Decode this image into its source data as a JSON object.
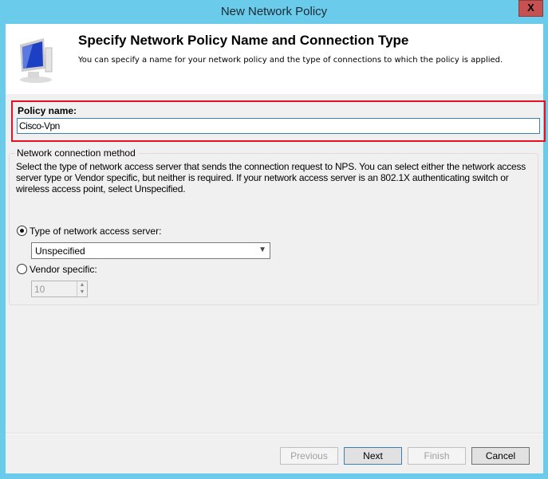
{
  "window": {
    "title": "New Network Policy",
    "close_label": "X"
  },
  "header": {
    "title": "Specify Network Policy Name and Connection Type",
    "subtitle": "You can specify a name for your network policy and the type of connections to which the policy is applied.",
    "icon": "computer-monitor-icon"
  },
  "policy": {
    "label": "Policy name:",
    "value": "Cisco-Vpn",
    "highlight_color": "#e81123"
  },
  "method": {
    "legend": "Network connection method",
    "description": "Select the type of network access server that sends the connection request to NPS. You can select either the network access server type or Vendor specific, but neither is required.  If your network access server is an 802.1X authenticating switch or wireless access point, select Unspecified.",
    "type_option": {
      "label": "Type of network access server:",
      "selected": true
    },
    "type_select": {
      "value": "Unspecified"
    },
    "vendor_option": {
      "label": "Vendor specific:",
      "selected": false
    },
    "vendor_value": "10"
  },
  "buttons": {
    "previous": "Previous",
    "next": "Next",
    "finish": "Finish",
    "cancel": "Cancel"
  }
}
